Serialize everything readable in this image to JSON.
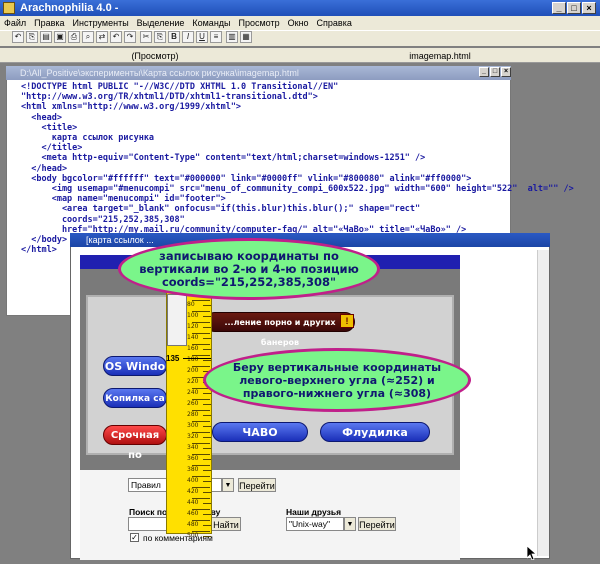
{
  "window": {
    "title": "Arachnophilia 4.0 -"
  },
  "menu": [
    "Файл",
    "Правка",
    "Инструменты",
    "Выделение",
    "Команды",
    "Просмотр",
    "Окно",
    "Справка"
  ],
  "toolbar": {
    "buttons": [
      "undo-icon",
      "copy-icon",
      "paste-icon",
      "save-icon",
      "print-icon",
      "find-icon",
      "replace-icon",
      "undo2-icon",
      "redo-icon",
      "cut-icon",
      "copy2-icon",
      "paste2-icon",
      "bold-icon",
      "italic-icon",
      "underline-icon",
      "list-icon",
      "chart-icon",
      "image-icon"
    ],
    "bold": "B",
    "italic": "I",
    "underline": "U"
  },
  "tabs": {
    "preview": "(Просмотр)",
    "file": "imagemap.html"
  },
  "code_window": {
    "title": "D:\\All_Positive\\эксперименты\\Карта ссылок рисунка\\imagemap.html",
    "lines": [
      "<!DOCTYPE html PUBLIC \"-//W3C//DTD XHTML 1.0 Transitional//EN\"",
      "\"http://www.w3.org/TR/xhtml1/DTD/xhtml1-transitional.dtd\">",
      "<html xmlns=\"http://www.w3.org/1999/xhtml\">",
      "  <head>",
      "    <title>",
      "      карта ссылок рисунка",
      "    </title>",
      "    <meta http-equiv=\"Content-Type\" content=\"text/html;charset=windows-1251\" />",
      "  </head>",
      "  <body bgcolor=\"#ffffff\" text=\"#000000\" link=\"#0000ff\" vlink=\"#800080\" alink=\"#ff0000\">",
      "      <img usemap=\"#menucompi\" src=\"menu_of_community_compi_600x522.jpg\" width=\"600\" height=\"522\"  alt=\"\" />",
      "      <map name=\"menucompi\" id=\"footer\">",
      "        <area target=\"_blank\" onfocus=\"if(this.blur)this.blur();\" shape=\"rect\"",
      "        coords=\"215,252,385,308\"",
      "        href=\"http://my.mail.ru/community/computer-faq/\" alt=\"«ЧаВо»\" title=\"«ЧаВо»\" />",
      "  </body>",
      "</html>"
    ]
  },
  "browser_window": {
    "title": "[карта ссылок ...",
    "buttons": {
      "banner": "...ление порно и других банеров",
      "os_windows": "OS Windo",
      "kopilka": "Копилка са",
      "srochnaya": "Срочная по",
      "chavo": "ЧАВО",
      "fludilka": "Флудилка"
    },
    "forum_select": "Правил",
    "go1": "Перейти",
    "search_label": "Поиск по сообществу",
    "search_button": "Найти",
    "search_value": "",
    "friends_label": "Наши друзья",
    "friends_select": "\"Unix-way\"",
    "go2": "Перейти",
    "comments_checkbox": "по комментариям",
    "comments_checked": true
  },
  "ruler": {
    "marker": "135",
    "ticks": [
      "80",
      "100",
      "120",
      "140",
      "160",
      "180",
      "200",
      "220",
      "240",
      "260",
      "280",
      "300",
      "320",
      "340",
      "360",
      "380",
      "400",
      "420",
      "440",
      "460",
      "480",
      "500"
    ]
  },
  "annotations": {
    "top": "записываю координаты по вертикали во 2-ю и 4-ю позицию coords=\"215,252,385,308\"",
    "middle": "Беру вертикальные координаты левого-верхнего угла (≈252) и правого-нижнего угла (≈308)"
  }
}
